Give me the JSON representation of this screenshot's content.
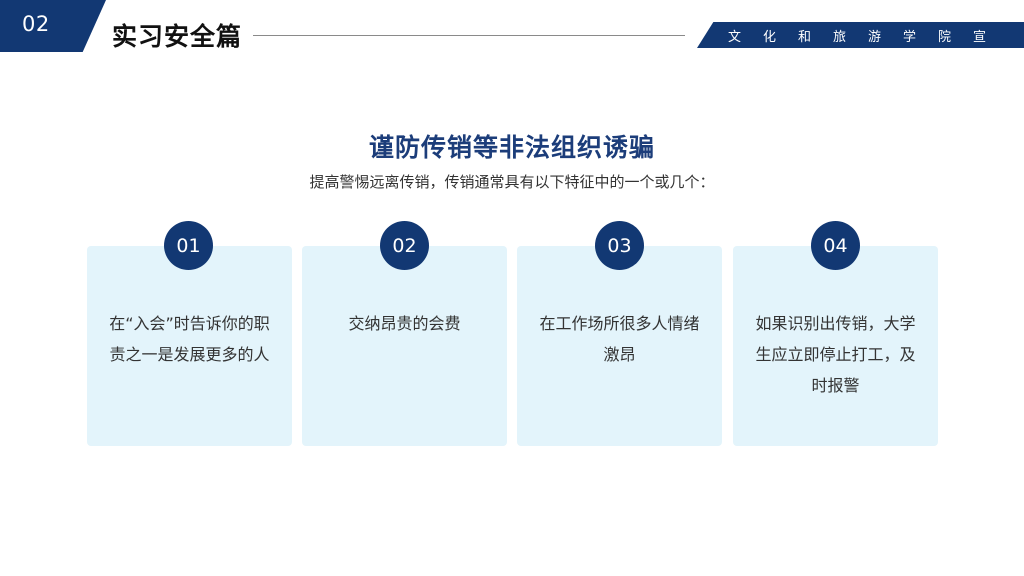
{
  "header": {
    "section_number": "02",
    "section_title": "实习安全篇",
    "brand": "文化和旅游学院宣"
  },
  "main": {
    "heading": "谨防传销等非法组织诱骗",
    "subheading": "提高警惕远离传销，传销通常具有以下特征中的一个或几个："
  },
  "cards": [
    {
      "number": "01",
      "text": "在“入会”时告诉你的职责之一是发展更多的人"
    },
    {
      "number": "02",
      "text": "交纳昂贵的会费"
    },
    {
      "number": "03",
      "text": "在工作场所很多人情绪激昂"
    },
    {
      "number": "04",
      "text": "如果识别出传销，大学生应立即停止打工，及时报警"
    }
  ],
  "colors": {
    "primary": "#123873",
    "card_bg": "#e3f4fb",
    "heading": "#1c3d7a"
  }
}
